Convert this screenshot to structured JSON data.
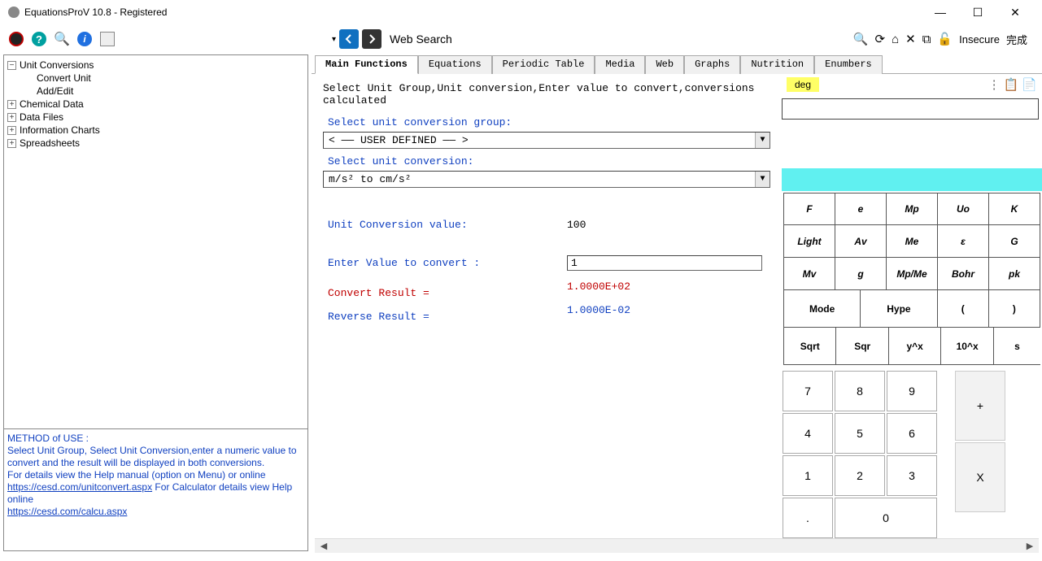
{
  "window": {
    "title": "EquationsProV 10.8 - Registered"
  },
  "toolbar": {
    "web_search_label": "Web Search",
    "insecure_label": "Insecure",
    "done_label": "完成"
  },
  "tree": {
    "root": "Unit Conversions",
    "child1": "Convert Unit",
    "child2": "Add/Edit",
    "item2": "Chemical Data",
    "item3": "Data Files",
    "item4": "Information Charts",
    "item5": "Spreadsheets"
  },
  "help": {
    "line1": "METHOD of USE :",
    "line2": "Select Unit Group, Select Unit Conversion,enter a numeric value to convert and the result will be displayed in both conversions.",
    "line3": " For details view the Help manual (option on Menu) or online",
    "link1": "https://cesd.com/unitconvert.aspx",
    "mid": " For Calculator details view Help online",
    "link2": "https://cesd.com/calcu.aspx"
  },
  "tabs": {
    "t0": "Main Functions",
    "t1": "Equations",
    "t2": "Periodic Table",
    "t3": "Media",
    "t4": "Web",
    "t5": "Graphs",
    "t6": "Nutrition",
    "t7": "Enumbers"
  },
  "conversion": {
    "instruction": "Select Unit Group,Unit conversion,Enter value to convert,conversions calculated",
    "group_label": "Select unit conversion group:",
    "group_value": "< —— USER DEFINED —— >",
    "conv_label": "Select unit conversion:",
    "conv_value": "m/s² to cm/s²",
    "uc_value_label": "Unit Conversion value:",
    "uc_value": "100",
    "enter_label": "Enter Value to convert :",
    "enter_value": "1",
    "convert_result_label": "Convert Result =",
    "convert_result_value": "1.0000E+02",
    "reverse_result_label": "Reverse Result =",
    "reverse_result_value": "1.0000E-02"
  },
  "calc": {
    "deg": "deg",
    "row1": {
      "c1": "F",
      "c2": "e",
      "c3": "Mp",
      "c4": "Uo",
      "c5": "K"
    },
    "row2": {
      "c1": "Light",
      "c2": "Av",
      "c3": "Me",
      "c4": "ε",
      "c5": "G"
    },
    "row3": {
      "c1": "Mv",
      "c2": "g",
      "c3": "Mp/Me",
      "c4": "Bohr",
      "c5": "pk"
    },
    "row4": {
      "c1": "Mode",
      "c2": "Hype",
      "c3": "(",
      "c4": ")"
    },
    "row5": {
      "c1": "Sqrt",
      "c2": "Sqr",
      "c3": "y^x",
      "c4": "10^x",
      "c5": "s"
    },
    "num": {
      "n7": "7",
      "n8": "8",
      "n9": "9",
      "n4": "4",
      "n5": "5",
      "n6": "6",
      "n1": "1",
      "n2": "2",
      "n3": "3",
      "dot": ".",
      "n0": "0"
    },
    "ops": {
      "plus": "+",
      "x": "X"
    }
  }
}
